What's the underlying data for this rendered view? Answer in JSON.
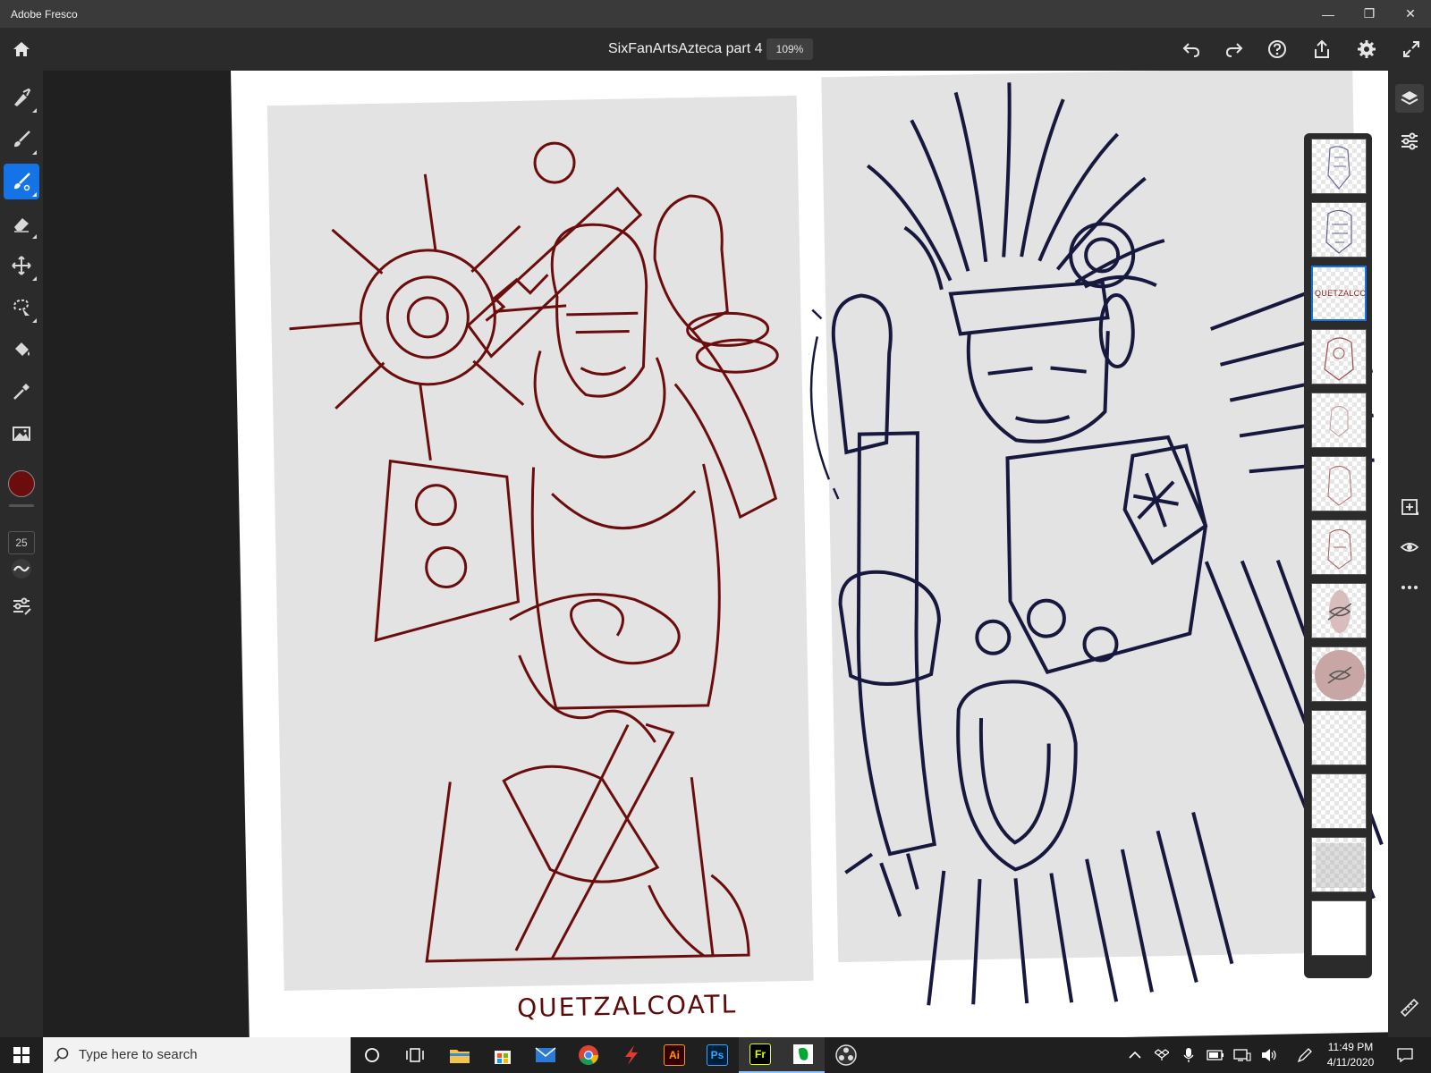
{
  "window": {
    "app_title": "Adobe Fresco",
    "controls": {
      "minimize": "—",
      "maximize": "❐",
      "close": "✕"
    }
  },
  "topbar": {
    "document_title": "SixFanArtsAzteca part 4",
    "zoom": "109%",
    "icons": [
      "home-icon",
      "undo-icon",
      "redo-icon",
      "help-icon",
      "share-icon",
      "settings-icon",
      "fullscreen-icon"
    ]
  },
  "tools": {
    "items": [
      "pixel-brush",
      "live-brush",
      "vector-brush",
      "eraser",
      "move-transform",
      "selection",
      "fill",
      "eyedropper",
      "place-image"
    ],
    "active": "vector-brush",
    "current_color": "#6b0d0d",
    "brush_size": "25"
  },
  "canvas": {
    "caption": "QUETZALCOATL",
    "line_color_left": "#6b0d0d",
    "line_color_right": "#17183d"
  },
  "layers": {
    "count": 13,
    "active_index": 2,
    "hidden_indices": [
      7,
      8
    ],
    "active_layer_text": "QUETZALCOATL"
  },
  "rightbar": {
    "icons": [
      "layers-icon",
      "layer-properties-icon",
      "add-layer-icon",
      "visibility-icon",
      "more-icon",
      "ruler-icon"
    ]
  },
  "taskbar": {
    "search_placeholder": "Type here to search",
    "time": "11:49 PM",
    "date": "4/11/2020",
    "apps": [
      "cortana",
      "task-view",
      "file-explorer",
      "store",
      "mail",
      "chrome",
      "app-red",
      "illustrator",
      "photoshop",
      "fresco",
      "evernote",
      "obs"
    ],
    "badges": {
      "illustrator": "Ai",
      "photoshop": "Ps",
      "fresco": "Fr"
    }
  },
  "accent": "#1473e6"
}
